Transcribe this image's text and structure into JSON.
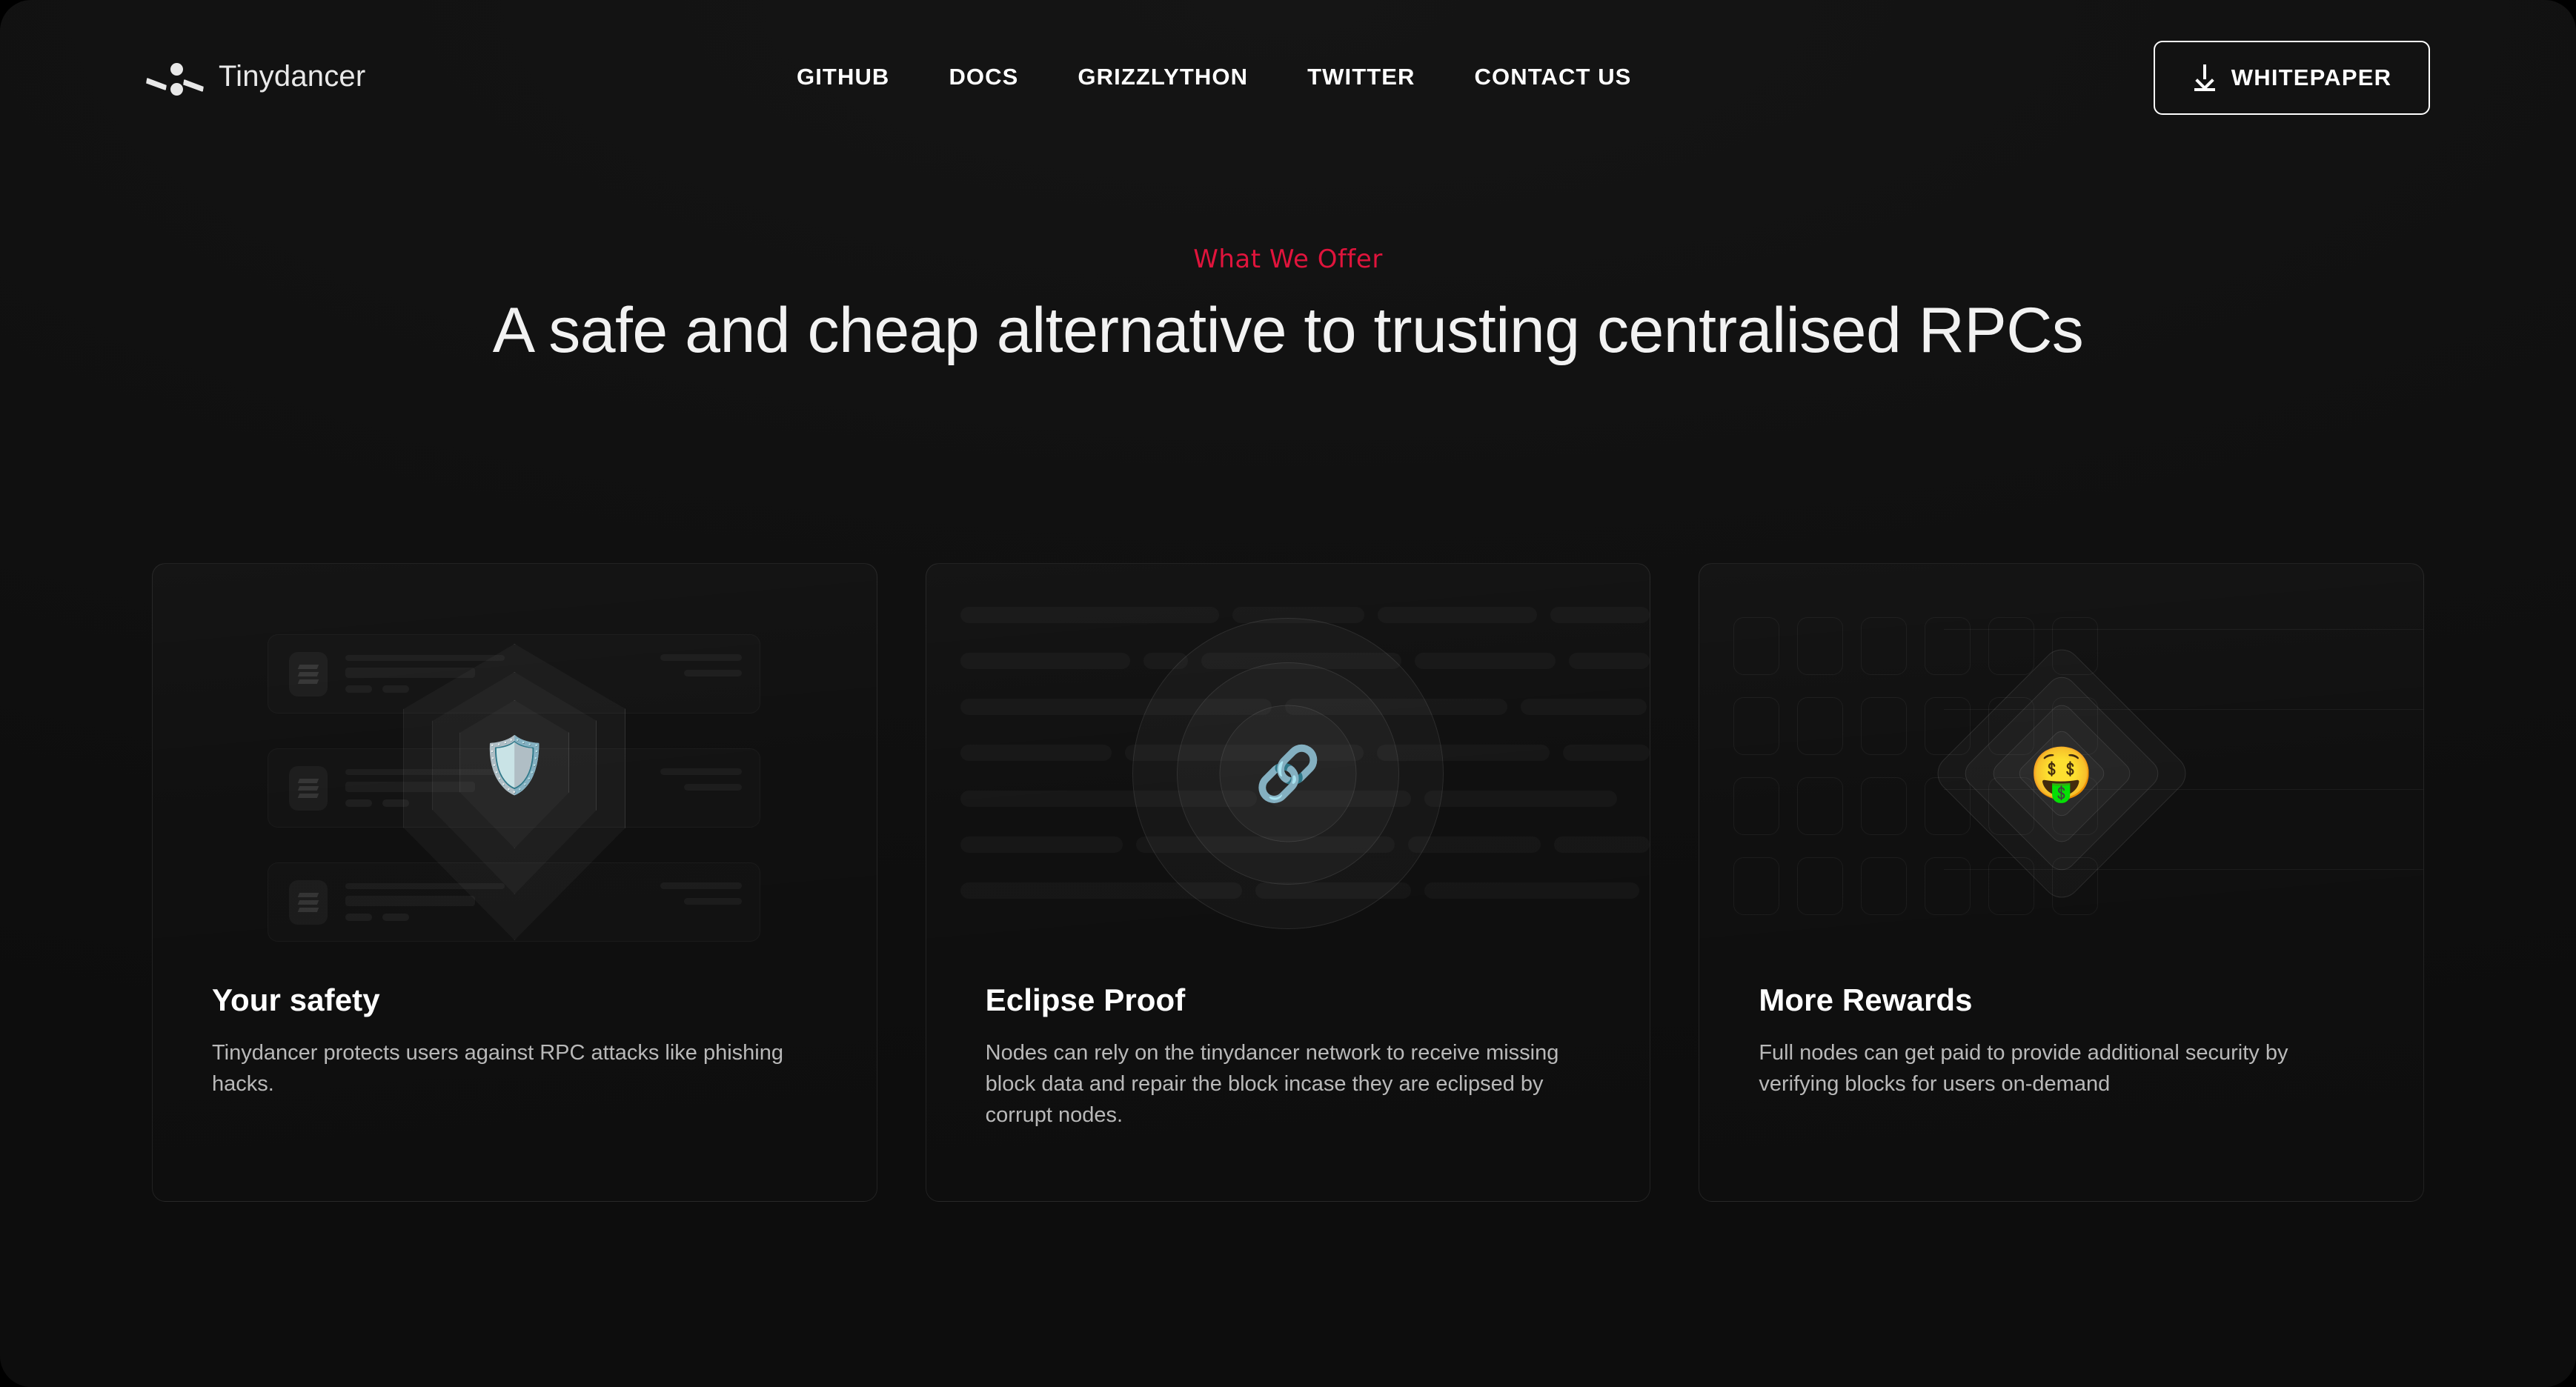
{
  "header": {
    "brand_name": "Tinydancer",
    "logo_icon": "tinydancer-logo-icon",
    "nav": [
      {
        "label": "GITHUB"
      },
      {
        "label": "DOCS"
      },
      {
        "label": "GRIZZLYTHON"
      },
      {
        "label": "TWITTER"
      },
      {
        "label": "CONTACT US"
      }
    ],
    "whitepaper_button": {
      "label": "WHITEPAPER",
      "icon": "download-icon"
    }
  },
  "hero": {
    "eyebrow": "What We Offer",
    "eyebrow_color": "#e0143c",
    "headline": "A safe and cheap alternative to trusting centralised RPCs"
  },
  "cards": [
    {
      "title": "Your safety",
      "description": "Tinydancer protects users against RPC attacks like phishing hacks.",
      "illustration": "shield-stack-illustration",
      "emoji": "🛡️",
      "emoji_name": "shield-emoji"
    },
    {
      "title": "Eclipse Proof",
      "description": "Nodes can rely on the tinydancer network to receive missing block data and repair the block incase they are eclipsed by corrupt nodes.",
      "illustration": "concentric-circles-illustration",
      "emoji": "🔗",
      "emoji_name": "chain-link-emoji"
    },
    {
      "title": "More Rewards",
      "description": "Full nodes can get paid to provide additional security by verifying blocks for users on-demand",
      "illustration": "nested-diamonds-illustration",
      "emoji": "🤑",
      "emoji_name": "money-mouth-face-emoji"
    }
  ],
  "theme": {
    "background": "#111111",
    "card_background": "#0e0e0e",
    "accent": "#e0143c",
    "text_primary": "#ffffff",
    "text_secondary": "#b9b9b9"
  }
}
